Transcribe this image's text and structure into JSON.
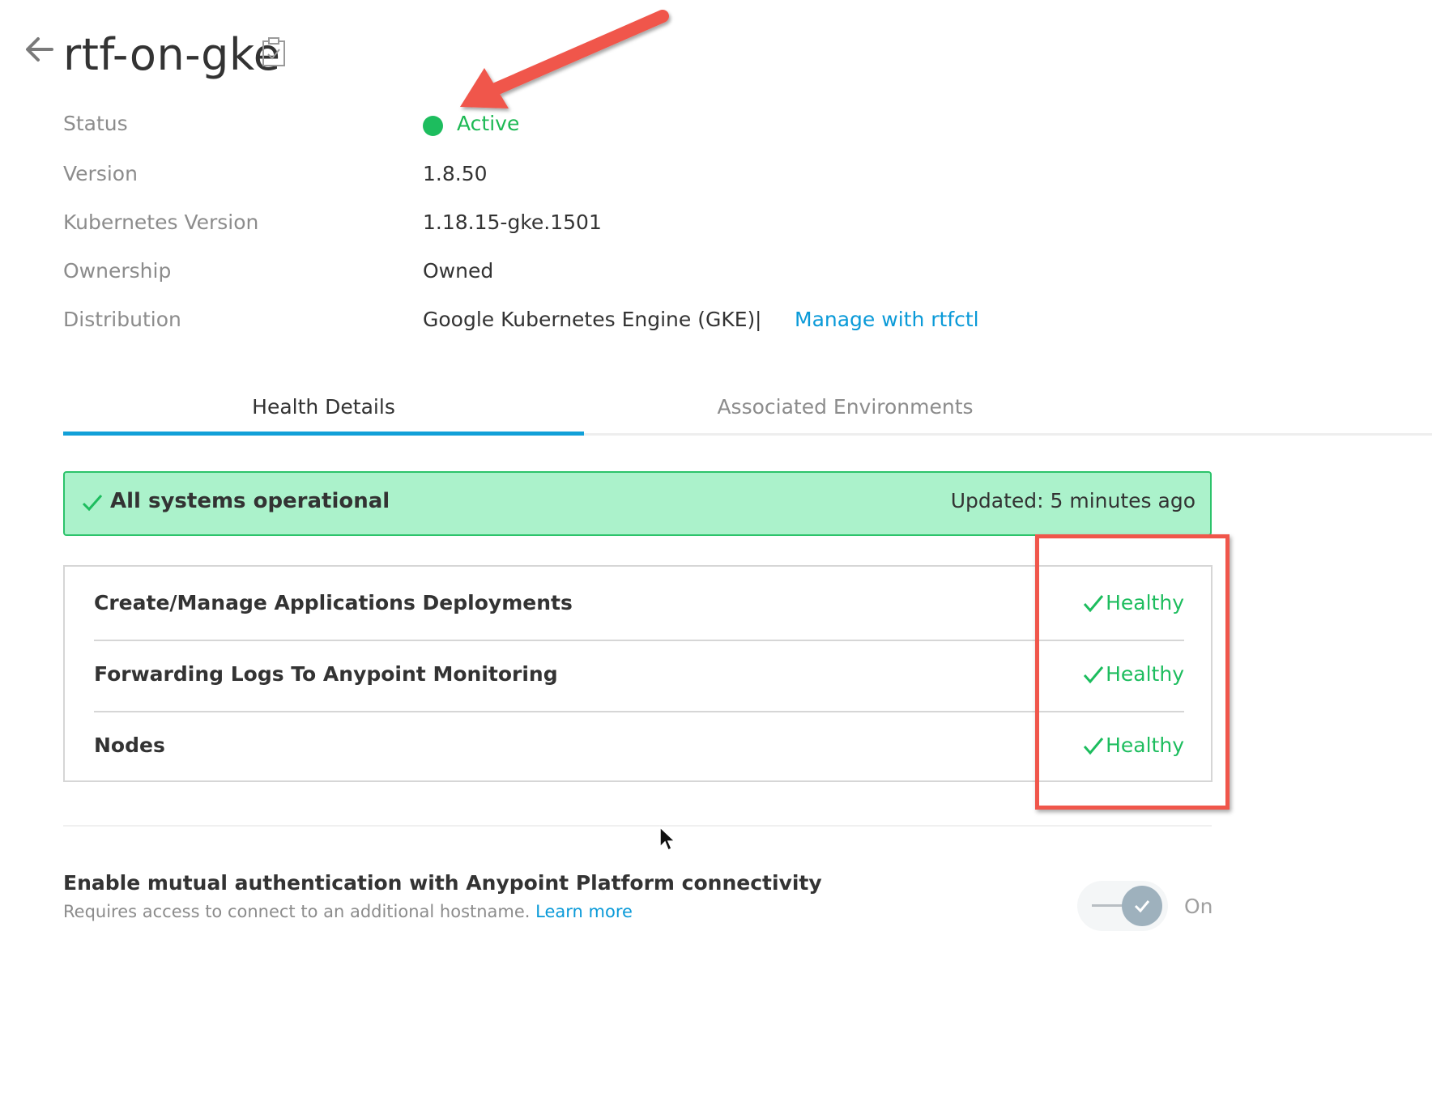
{
  "header": {
    "title": "rtf-on-gke"
  },
  "details": {
    "status": {
      "label": "Status",
      "value": "Active",
      "color": "#1dbd5e"
    },
    "version": {
      "label": "Version",
      "value": "1.8.50"
    },
    "kubernetes_version": {
      "label": "Kubernetes Version",
      "value": "1.18.15-gke.1501"
    },
    "ownership": {
      "label": "Ownership",
      "value": "Owned"
    },
    "distribution": {
      "label": "Distribution",
      "value": "Google Kubernetes Engine (GKE)",
      "separator": "|",
      "link": "Manage with rtfctl"
    }
  },
  "tabs": [
    {
      "label": "Health Details",
      "active": true
    },
    {
      "label": "Associated Environments",
      "active": false
    }
  ],
  "banner": {
    "text": "All systems operational",
    "updated": "Updated:  5 minutes ago"
  },
  "health_items": [
    {
      "label": "Create/Manage Applications Deployments",
      "status": "Healthy"
    },
    {
      "label": "Forwarding Logs To Anypoint Monitoring",
      "status": "Healthy"
    },
    {
      "label": "Nodes",
      "status": "Healthy"
    }
  ],
  "mutual_auth": {
    "title": "Enable mutual authentication with Anypoint Platform connectivity",
    "description": "Requires access to connect to an additional hostname.",
    "link": "Learn more",
    "toggle_label": "On",
    "enabled": true
  },
  "colors": {
    "accent": "#12a0d8",
    "link": "#0a9ad8",
    "success": "#1dbd5e",
    "banner_bg": "#abf2cb",
    "annotation": "#f0564b"
  }
}
